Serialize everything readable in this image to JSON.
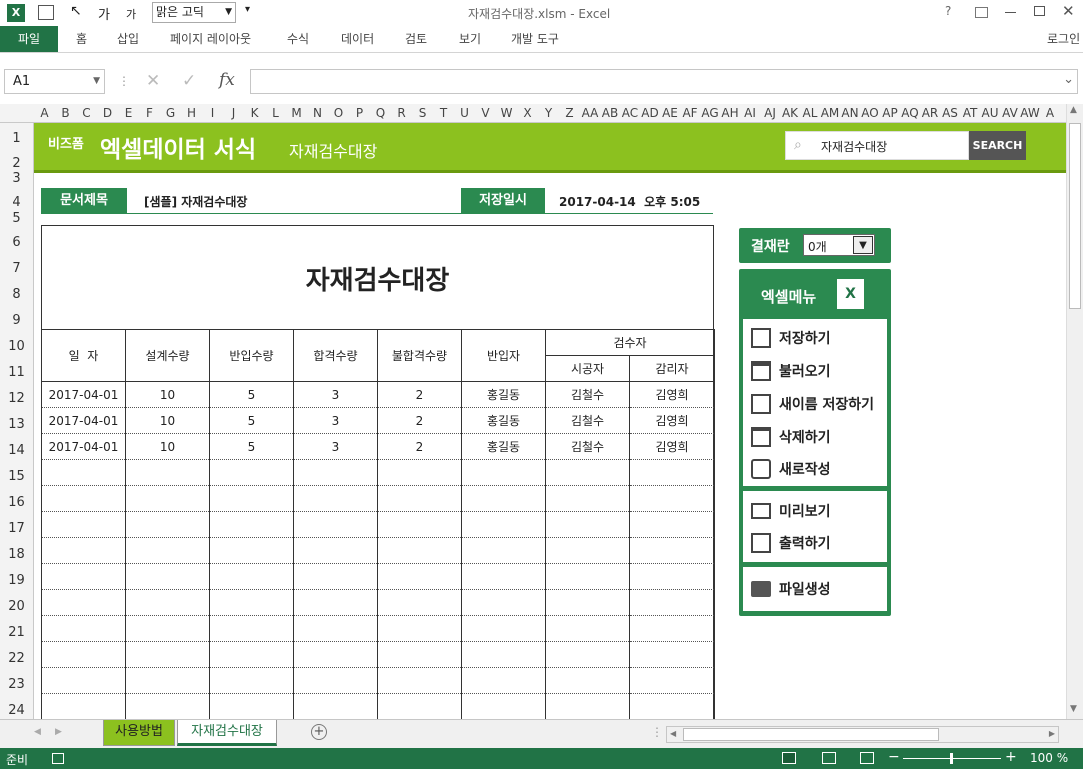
{
  "window": {
    "title": "자재검수대장.xlsm - Excel",
    "help": "?",
    "login": "로그인"
  },
  "qat": {
    "font_name": "맑은 고딕"
  },
  "ribbon": {
    "tabs": [
      "파일",
      "홈",
      "삽입",
      "페이지 레이아웃",
      "수식",
      "데이터",
      "검토",
      "보기",
      "개발 도구"
    ]
  },
  "formula_bar": {
    "name_box": "A1",
    "fx": "fx",
    "value": ""
  },
  "columns": [
    "A",
    "B",
    "C",
    "D",
    "E",
    "F",
    "G",
    "H",
    "I",
    "J",
    "K",
    "L",
    "M",
    "N",
    "O",
    "P",
    "Q",
    "R",
    "S",
    "T",
    "U",
    "V",
    "W",
    "X",
    "Y",
    "Z",
    "AA",
    "AB",
    "AC",
    "AD",
    "AE",
    "AF",
    "AG",
    "AH",
    "AI",
    "AJ",
    "AK",
    "AL",
    "AM",
    "AN",
    "AO",
    "AP",
    "AQ",
    "AR",
    "AS",
    "AT",
    "AU",
    "AV",
    "AW",
    "A"
  ],
  "rows": [
    "1",
    "2",
    "3",
    "4",
    "5",
    "6",
    "7",
    "8",
    "9",
    "10",
    "11",
    "12",
    "13",
    "14",
    "15",
    "16",
    "17",
    "18",
    "19",
    "20",
    "21",
    "22",
    "23",
    "24"
  ],
  "banner": {
    "brand_small": "비즈폼",
    "brand_big": "엑셀데이터 서식",
    "subtitle": "자재검수대장",
    "search_value": "자재검수대장",
    "search_button": "SEARCH"
  },
  "meta": {
    "title_label": "문서제목",
    "title_value": "[샘플] 자재검수대장",
    "date_label": "저장일시",
    "date_value": "2017-04-14  오후 5:05"
  },
  "document": {
    "heading": "자재검수대장"
  },
  "table": {
    "headers": [
      "일  자",
      "설계수량",
      "반입수량",
      "합격수량",
      "불합격수량",
      "반입자",
      "검수자"
    ],
    "sub_headers": [
      "시공자",
      "감리자"
    ],
    "rows": [
      [
        "2017-04-01",
        "10",
        "5",
        "3",
        "2",
        "홍길동",
        "김철수",
        "김영희"
      ],
      [
        "2017-04-01",
        "10",
        "5",
        "3",
        "2",
        "홍길동",
        "김철수",
        "김영희"
      ],
      [
        "2017-04-01",
        "10",
        "5",
        "3",
        "2",
        "홍길동",
        "김철수",
        "김영희"
      ]
    ],
    "empty_rows": 10
  },
  "approval": {
    "label": "결재란",
    "value": "0개"
  },
  "menu": {
    "title": "엑셀메뉴",
    "group1": [
      "저장하기",
      "불러오기",
      "새이름 저장하기",
      "삭제하기",
      "새로작성"
    ],
    "group2": [
      "미리보기",
      "출력하기"
    ],
    "group3": [
      "파일생성"
    ]
  },
  "sheets": {
    "tabs": [
      "사용방법",
      "자재검수대장"
    ],
    "active": 1
  },
  "status": {
    "ready": "준비",
    "zoom": "100 %"
  },
  "colors": {
    "excel_green": "#217346",
    "banner_green": "#8cc11f",
    "panel_green": "#2b8a50"
  }
}
